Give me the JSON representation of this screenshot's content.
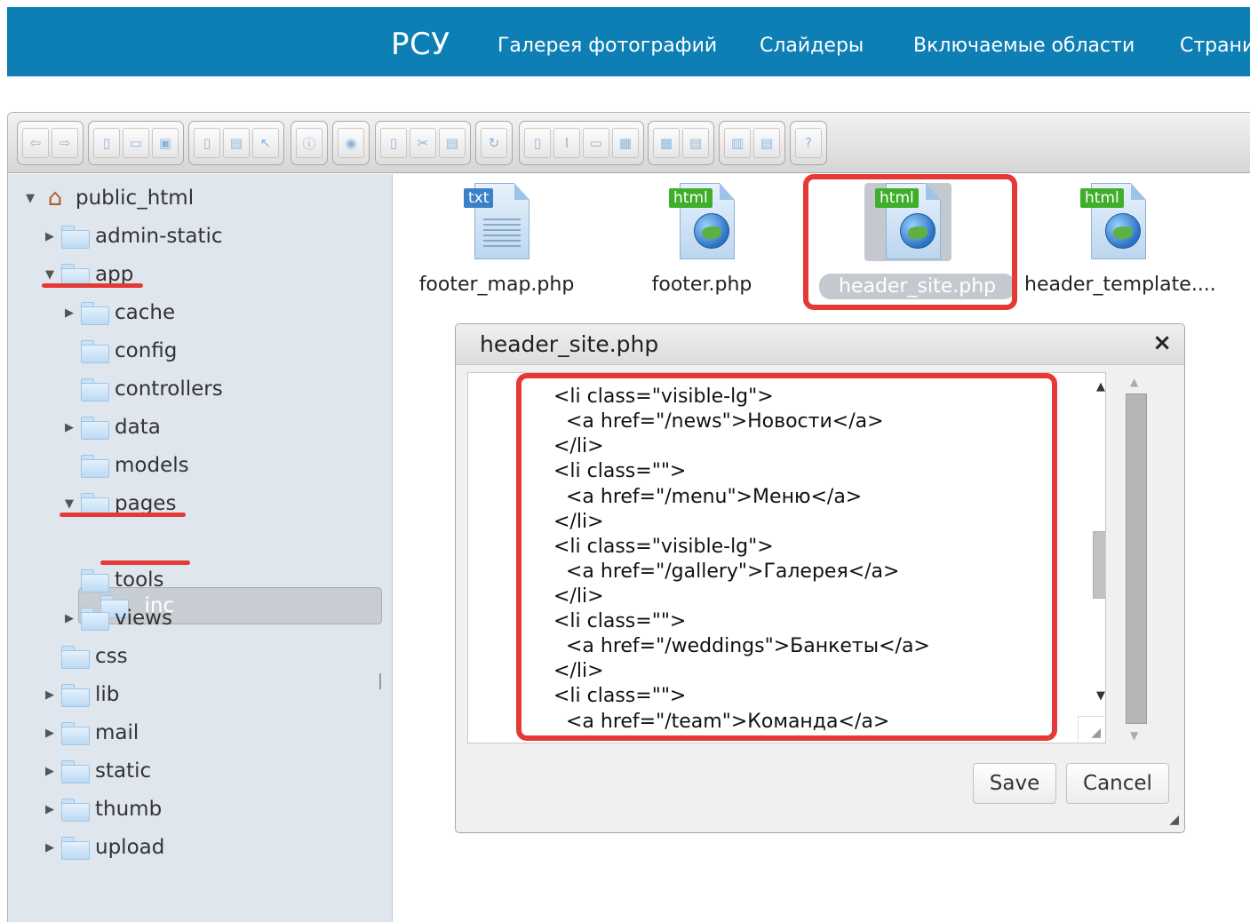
{
  "nav": {
    "brand": "РСУ",
    "links": [
      "Галерея фотографий",
      "Слайдеры",
      "Включаемые области",
      "Страни"
    ]
  },
  "toolbar": {
    "groups": [
      [
        "back-icon",
        "forward-icon"
      ],
      [
        "new-file-icon",
        "new-folder-icon",
        "save-icon"
      ],
      [
        "open-icon",
        "download-icon",
        "upload-icon"
      ],
      [
        "info-icon"
      ],
      [
        "preview-icon"
      ],
      [
        "copy-icon",
        "cut-icon",
        "paste-icon"
      ],
      [
        "refresh-icon"
      ],
      [
        "duplicate-icon",
        "rename-icon",
        "edit-icon",
        "extract-icon"
      ],
      [
        "archive-icon",
        "add-icon"
      ],
      [
        "view-list-icon",
        "sort-icon"
      ],
      [
        "help-icon"
      ]
    ]
  },
  "tree": {
    "root": "public_html",
    "items": [
      {
        "label": "admin-static"
      },
      {
        "label": "app"
      },
      {
        "label": "cache"
      },
      {
        "label": "config"
      },
      {
        "label": "controllers"
      },
      {
        "label": "data"
      },
      {
        "label": "models"
      },
      {
        "label": "pages"
      },
      {
        "label": "_inc"
      },
      {
        "label": "tools"
      },
      {
        "label": "views"
      },
      {
        "label": "css"
      },
      {
        "label": "lib"
      },
      {
        "label": "mail"
      },
      {
        "label": "static"
      },
      {
        "label": "thumb"
      },
      {
        "label": "upload"
      }
    ],
    "selected": "_inc"
  },
  "files": [
    {
      "name": "footer_map.php",
      "type": "txt"
    },
    {
      "name": "footer.php",
      "type": "html"
    },
    {
      "name": "header_site.php",
      "type": "html",
      "selected": true
    },
    {
      "name": "header_template....",
      "type": "html"
    }
  ],
  "editor": {
    "title": "header_site.php",
    "close": "×",
    "lines": [
      "<li class=\"visible-lg\">",
      "  <a href=\"/news\">Новости</a>",
      "</li>",
      "<li class=\"\">",
      "  <a href=\"/menu\">Меню</a>",
      "</li>",
      "<li class=\"visible-lg\">",
      "  <a href=\"/gallery\">Галерея</a>",
      "</li>",
      "<li class=\"\">",
      "  <a href=\"/weddings\">Банкеты</a>",
      "</li>",
      "<li class=\"\">",
      "  <a href=\"/team\">Команда</a>"
    ],
    "save_label": "Save",
    "cancel_label": "Cancel"
  },
  "colors": {
    "nav_bg": "#0e7fb4",
    "highlight": "#e53935",
    "sidebar_bg": "#dfe6ee"
  }
}
